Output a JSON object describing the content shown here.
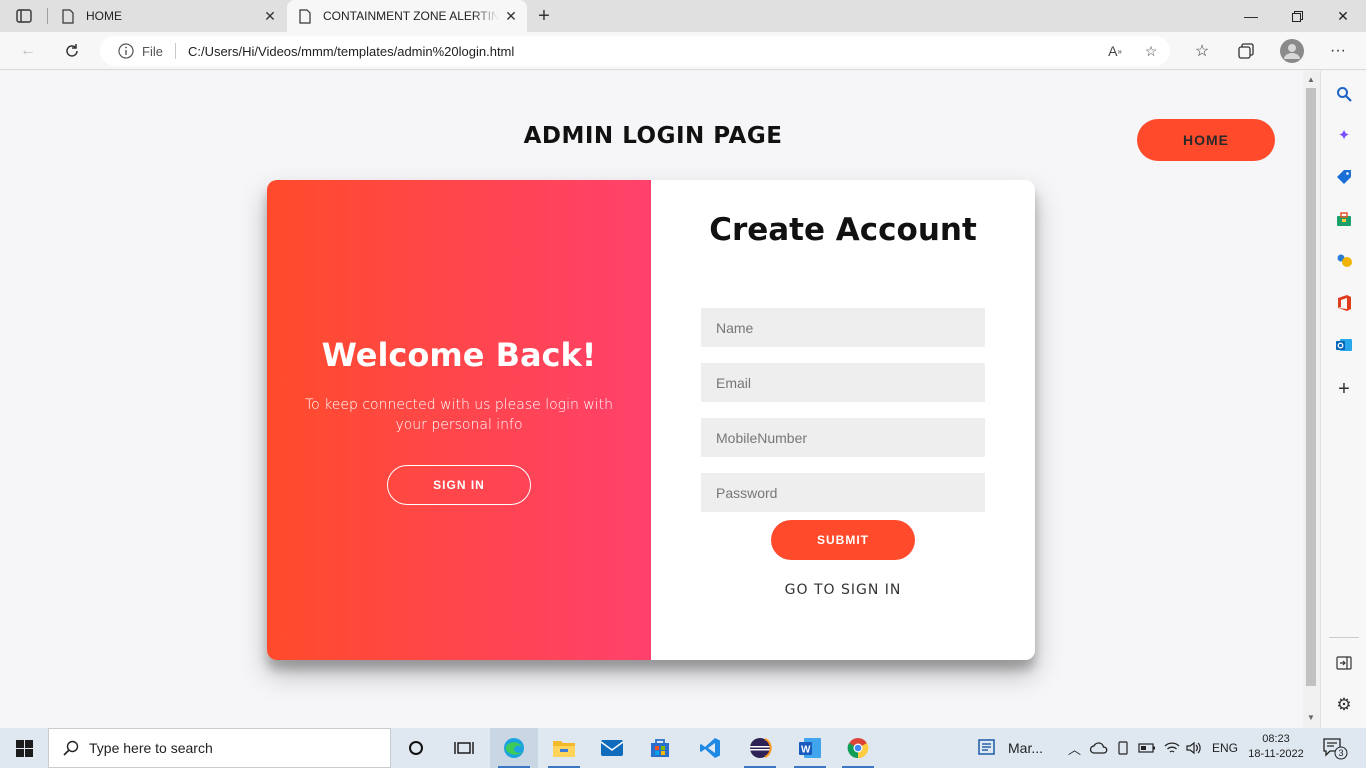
{
  "browser": {
    "tabs": [
      {
        "title": "HOME",
        "active": false
      },
      {
        "title": "CONTAINMENT ZONE ALERTING",
        "active": true
      }
    ],
    "address": {
      "scheme_label": "File",
      "url": "C:/Users/Hi/Videos/mmm/templates/admin%20login.html"
    }
  },
  "page": {
    "title": "ADMIN LOGIN PAGE",
    "home_button": "HOME",
    "overlay": {
      "heading": "Welcome Back!",
      "text": "To keep connected with us please login with your personal info",
      "button": "SIGN IN"
    },
    "form": {
      "heading": "Create Account",
      "fields": [
        {
          "placeholder": "Name"
        },
        {
          "placeholder": "Email"
        },
        {
          "placeholder": "MobileNumber"
        },
        {
          "placeholder": "Password"
        }
      ],
      "submit": "SUBMIT",
      "link": "GO TO SIGN IN"
    },
    "colors": {
      "accent": "#ff4b2b",
      "accent_end": "#ff416c"
    }
  },
  "taskbar": {
    "search_placeholder": "Type here to search",
    "weather_label": "Mar...",
    "language": "ENG",
    "time": "08:23",
    "date": "18-11-2022",
    "notifications": "3"
  }
}
